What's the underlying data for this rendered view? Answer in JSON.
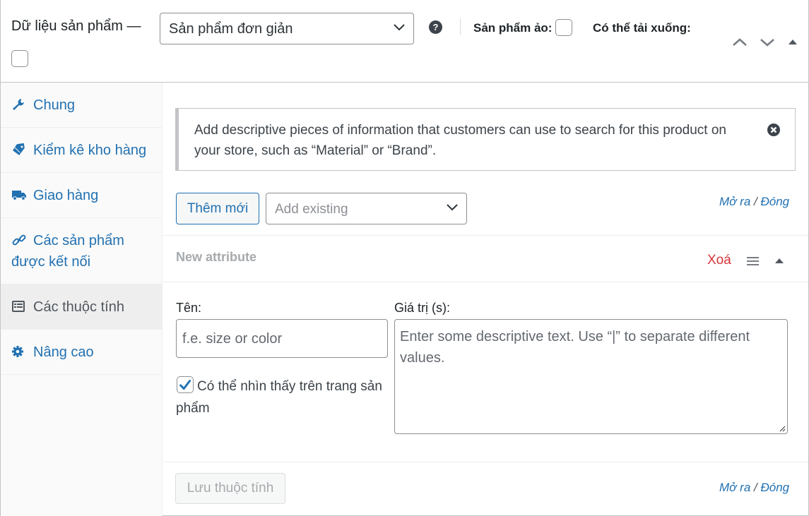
{
  "header": {
    "title": "Dữ liệu sản phẩm —",
    "product_type": "Sản phẩm đơn giản",
    "help_icon": "help-circle-icon",
    "virtual_label": "Sản phẩm ảo:",
    "virtual_checked": false,
    "downloadable_label": "Có thể tải xuống:",
    "downloadable_checked": false
  },
  "sidebar": {
    "items": [
      {
        "label": "Chung",
        "icon": "wrench-icon"
      },
      {
        "label": "Kiểm kê kho hàng",
        "icon": "tag-icon"
      },
      {
        "label": "Giao hàng",
        "icon": "truck-icon"
      },
      {
        "label": "Các sản phẩm được kết nối",
        "icon": "link-icon"
      },
      {
        "label": "Các thuộc tính",
        "icon": "list-view-icon",
        "active": true
      },
      {
        "label": "Nâng cao",
        "icon": "gear-icon"
      }
    ]
  },
  "notice": {
    "text": "Add descriptive pieces of information that customers can use to search for this product on your store, such as “Material” or “Brand”."
  },
  "toolbar": {
    "add_new_label": "Thêm mới",
    "add_existing_placeholder": "Add existing",
    "expand_label": "Mở ra",
    "separator": "/",
    "close_label": "Đóng"
  },
  "attribute": {
    "title": "New attribute",
    "remove_label": "Xoá",
    "name_label": "Tên:",
    "name_placeholder": "f.e. size or color",
    "values_label": "Giá trị (s):",
    "values_placeholder": "Enter some descriptive text. Use “|” to separate different values.",
    "visible_label": "Có thể nhìn thấy trên trang sản phẩm",
    "visible_checked": true
  },
  "footer": {
    "save_label": "Lưu thuộc tính",
    "expand_label": "Mở ra",
    "separator": "/",
    "close_label": "Đóng"
  },
  "colors": {
    "link": "#2271b1",
    "remove": "#d63638",
    "active_tab_bg": "#eeeeee"
  }
}
